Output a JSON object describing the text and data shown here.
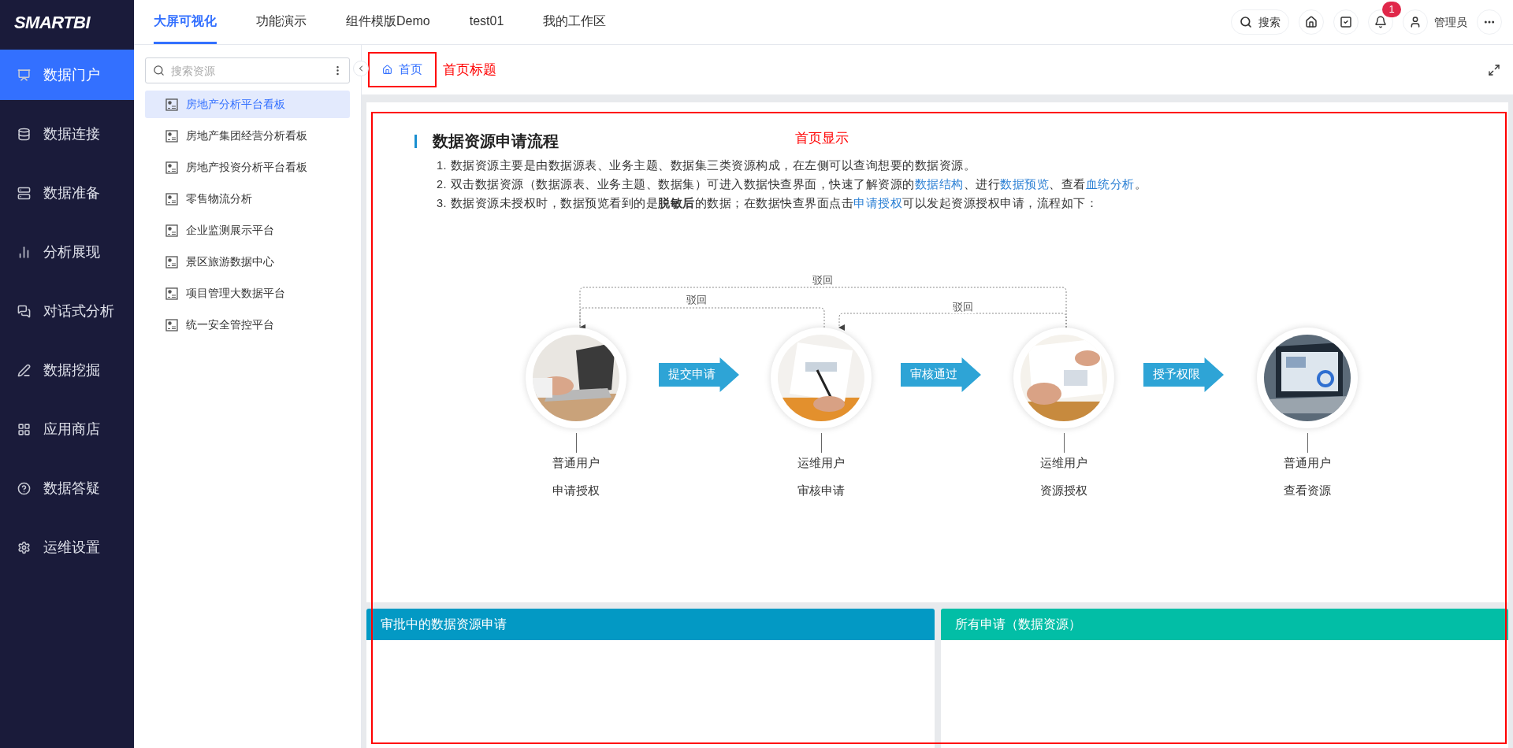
{
  "logo": "SMARTBI",
  "top_tabs": [
    {
      "label": "大屏可视化",
      "selected": true
    },
    {
      "label": "功能演示",
      "selected": false
    },
    {
      "label": "组件模版Demo",
      "selected": false
    },
    {
      "label": "test01",
      "selected": false
    },
    {
      "label": "我的工作区",
      "selected": false
    }
  ],
  "top_actions": {
    "search": "搜索",
    "notification_count": "1",
    "user": "管理员"
  },
  "nav": [
    {
      "label": "数据门户",
      "selected": true
    },
    {
      "label": "数据连接",
      "selected": false
    },
    {
      "label": "数据准备",
      "selected": false
    },
    {
      "label": "分析展现",
      "selected": false
    },
    {
      "label": "对话式分析",
      "selected": false
    },
    {
      "label": "数据挖掘",
      "selected": false
    },
    {
      "label": "应用商店",
      "selected": false
    },
    {
      "label": "数据答疑",
      "selected": false
    },
    {
      "label": "运维设置",
      "selected": false
    }
  ],
  "resource_search": {
    "placeholder": "搜索资源"
  },
  "resources": [
    {
      "label": "房地产分析平台看板",
      "selected": true
    },
    {
      "label": "房地产集团经营分析看板",
      "selected": false
    },
    {
      "label": "房地产投资分析平台看板",
      "selected": false
    },
    {
      "label": "零售物流分析",
      "selected": false
    },
    {
      "label": "企业监测展示平台",
      "selected": false
    },
    {
      "label": "景区旅游数据中心",
      "selected": false
    },
    {
      "label": "项目管理大数据平台",
      "selected": false
    },
    {
      "label": "统一安全管控平台",
      "selected": false
    }
  ],
  "page_tab": {
    "label": "首页"
  },
  "page_title_note": "首页标题",
  "content_note": "首页显示",
  "article": {
    "title": "数据资源申请流程",
    "lines": [
      [
        {
          "kind": "text",
          "text": "1. 数据资源主要是由数据源表、业务主题、数据集三类资源构成，在左侧可以查询想要的数据资源。"
        }
      ],
      [
        {
          "kind": "text",
          "text": "2. 双击数据资源（数据源表、业务主题、数据集）可进入数据快查界面，快速了解资源的"
        },
        {
          "kind": "link",
          "text": "数据结构"
        },
        {
          "kind": "text",
          "text": "、进行"
        },
        {
          "kind": "link",
          "text": "数据预览"
        },
        {
          "kind": "text",
          "text": "、查看"
        },
        {
          "kind": "link",
          "text": "血统分析"
        },
        {
          "kind": "text",
          "text": "。"
        }
      ],
      [
        {
          "kind": "text",
          "text": "3. 数据资源未授权时，数据预览看到的是"
        },
        {
          "kind": "bold",
          "text": "脱敏后"
        },
        {
          "kind": "text",
          "text": "的数据；在数据快查界面点击"
        },
        {
          "kind": "link",
          "text": "申请授权"
        },
        {
          "kind": "text",
          "text": "可以发起资源授权申请，流程如下："
        }
      ]
    ]
  },
  "flow": {
    "steps": [
      {
        "role": "普通用户",
        "action": "申请授权"
      },
      {
        "role": "运维用户",
        "action": "审核申请"
      },
      {
        "role": "运维用户",
        "action": "资源授权"
      },
      {
        "role": "普通用户",
        "action": "查看资源"
      }
    ],
    "transitions": [
      "提交申请",
      "审核通过",
      "授予权限"
    ],
    "rejections": [
      "驳回",
      "驳回",
      "驳回"
    ]
  },
  "panels": [
    {
      "title": "审批中的数据资源申请",
      "color": "#0399c4"
    },
    {
      "title": "所有申请（数据资源）",
      "color": "#02bea6"
    }
  ]
}
